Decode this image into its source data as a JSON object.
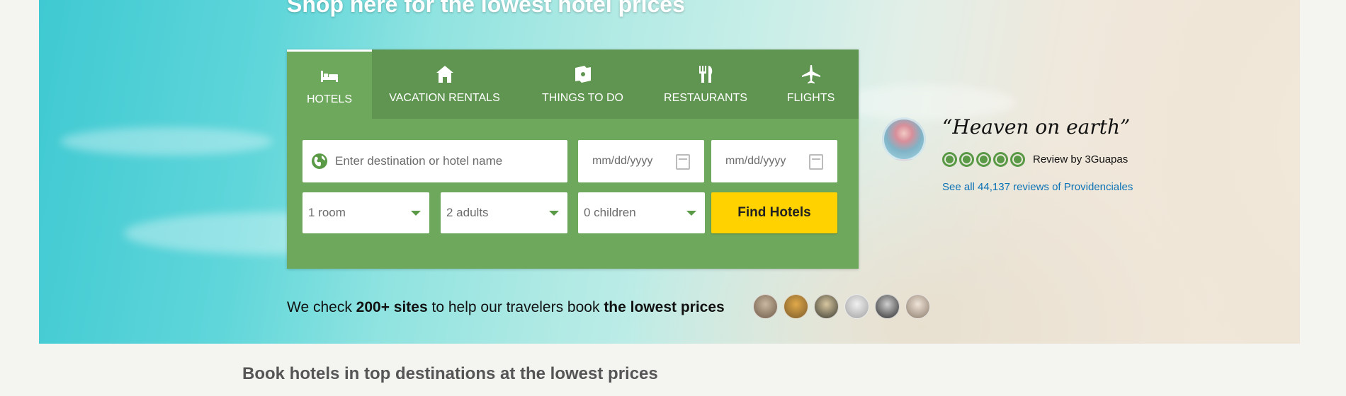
{
  "hero": {
    "headline": "Shop here for the lowest hotel prices"
  },
  "tabs": [
    {
      "label": "HOTELS",
      "icon": "bed-icon",
      "active": true
    },
    {
      "label": "VACATION RENTALS",
      "icon": "house-icon",
      "active": false
    },
    {
      "label": "THINGS TO DO",
      "icon": "ticket-icon",
      "active": false
    },
    {
      "label": "RESTAURANTS",
      "icon": "fork-knife-icon",
      "active": false
    },
    {
      "label": "FLIGHTS",
      "icon": "plane-icon",
      "active": false
    }
  ],
  "search": {
    "destination_placeholder": "Enter destination or hotel name",
    "checkin_placeholder": "mm/dd/yyyy",
    "checkout_placeholder": "mm/dd/yyyy",
    "rooms": "1 room",
    "adults": "2 adults",
    "children": "0 children",
    "button_label": "Find Hotels"
  },
  "tagline": {
    "prefix": "We check ",
    "sites": "200+ sites",
    "middle": " to help our travelers book ",
    "emphasis": "the lowest prices"
  },
  "review": {
    "quote": "“Heaven on earth”",
    "rating": 5,
    "byline": "Review by 3Guapas",
    "link": "See all 44,137 reviews of Providenciales"
  },
  "section": {
    "title": "Book hotels in top destinations at the lowest prices"
  },
  "colors": {
    "panel": "#6ea85c",
    "tabbar": "#5f9550",
    "button": "#ffd200",
    "link": "#0b72b5",
    "bubble": "#5a9a47"
  }
}
